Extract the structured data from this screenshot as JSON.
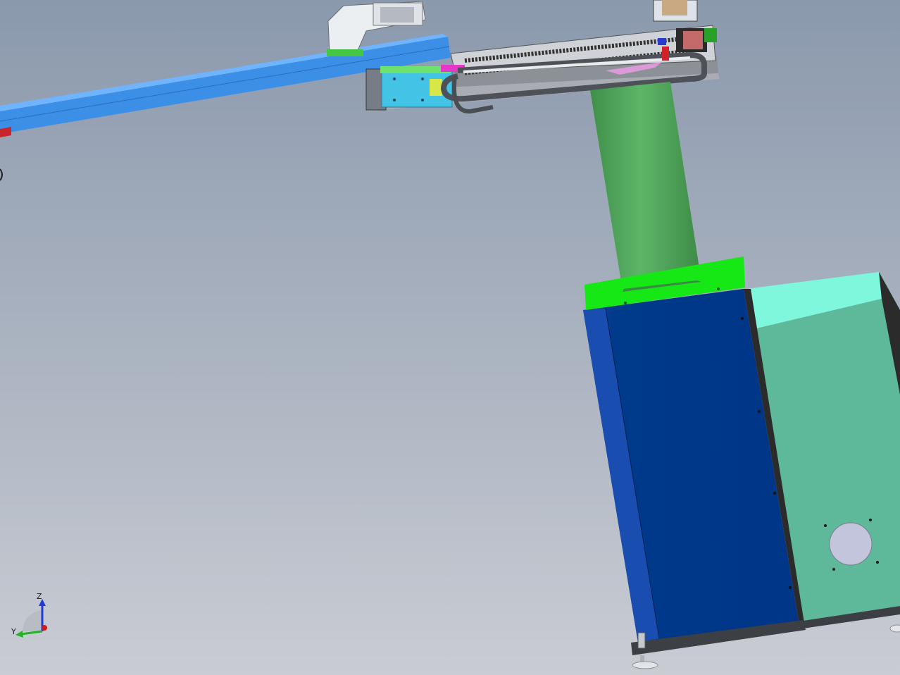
{
  "app": {
    "type": "cad-3d-viewport"
  },
  "triad": {
    "z_label": "Z",
    "y_label": "Y",
    "x_label": "",
    "colors": {
      "z": "#1f3ad6",
      "y": "#21b521",
      "x": "#d21a1a"
    }
  },
  "scene": {
    "background_top": "#8b99ad",
    "background_bottom": "#c9ccd3",
    "parts": [
      "long-blue-arm",
      "gripper-head",
      "linear-slide-module",
      "cable-carrier",
      "green-column",
      "lime-mount-plate",
      "navy-cabinet",
      "teal-side-cabinet",
      "round-port",
      "leveling-feet",
      "motor-mount"
    ]
  }
}
